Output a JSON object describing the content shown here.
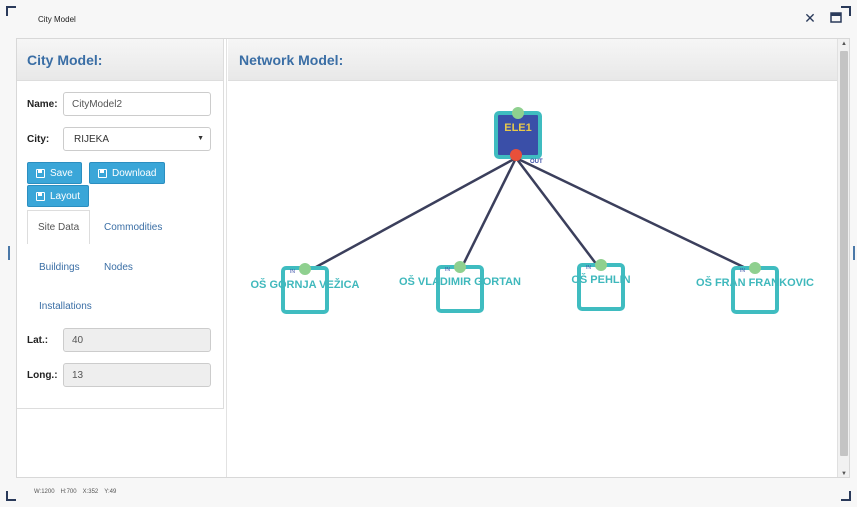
{
  "window": {
    "title": "City Model"
  },
  "city_panel": {
    "heading": "City Model:",
    "name_label": "Name:",
    "name_value": "CityModel2",
    "city_label": "City:",
    "city_value": "RIJEKA",
    "buttons": {
      "save": "Save",
      "download": "Download",
      "layout": "Layout"
    },
    "tabs": [
      "Site Data",
      "Commodities",
      "Buildings",
      "Nodes",
      "Installations"
    ],
    "lat_label": "Lat.:",
    "lat_value": "40",
    "long_label": "Long.:",
    "long_value": "13"
  },
  "network_panel": {
    "heading": "Network Model:",
    "source_node": {
      "label": "ELE1",
      "in_port": "",
      "out_port": "OUT"
    },
    "nodes": [
      {
        "label": "OŠ GORNJA VEŽICA",
        "port": "IN"
      },
      {
        "label": "OŠ VLADIMIR GORTAN",
        "port": "IN"
      },
      {
        "label": "OŠ PEHLIN",
        "port": "IN"
      },
      {
        "label": "OŠ FRAN FRANKOVIC",
        "port": "IN"
      }
    ],
    "colors": {
      "link": "#3b3f5c",
      "node_border": "#3fbcc0",
      "source_fill": "#3a4fa8",
      "port_green": "#8fd08f",
      "port_red": "#e8503a",
      "label": "#3fb8bc"
    }
  },
  "status": {
    "width": "W:1200",
    "height": "H:700",
    "x": "X:352",
    "y": "Y:49"
  }
}
